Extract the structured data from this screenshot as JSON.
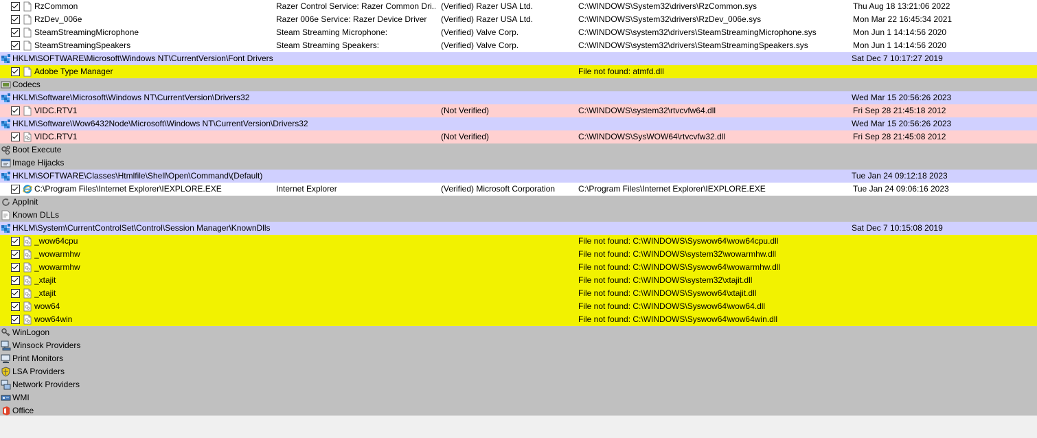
{
  "rows": [
    {
      "type": "item",
      "style": "ok",
      "icon": "file",
      "entry": "RzCommon",
      "description": "Razer Control Service: Razer Common Dri...",
      "publisher": "(Verified) Razer USA Ltd.",
      "image": "C:\\WINDOWS\\System32\\drivers\\RzCommon.sys",
      "time": "Thu Aug 18 13:21:06 2022"
    },
    {
      "type": "item",
      "style": "ok",
      "icon": "file",
      "entry": "RzDev_006e",
      "description": "Razer 006e Service: Razer Device Driver",
      "publisher": "(Verified) Razer USA Ltd.",
      "image": "C:\\WINDOWS\\System32\\drivers\\RzDev_006e.sys",
      "time": "Mon Mar 22 16:45:34 2021"
    },
    {
      "type": "item",
      "style": "ok",
      "icon": "file",
      "entry": "SteamStreamingMicrophone",
      "description": "Steam Streaming Microphone:",
      "publisher": "(Verified) Valve Corp.",
      "image": "C:\\WINDOWS\\system32\\drivers\\SteamStreamingMicrophone.sys",
      "time": "Mon Jun  1 14:14:56 2020"
    },
    {
      "type": "item",
      "style": "ok",
      "icon": "file",
      "entry": "SteamStreamingSpeakers",
      "description": "Steam Streaming Speakers:",
      "publisher": "(Verified) Valve Corp.",
      "image": "C:\\WINDOWS\\system32\\drivers\\SteamStreamingSpeakers.sys",
      "time": "Mon Jun  1 14:14:56 2020"
    },
    {
      "type": "key",
      "icon": "registry",
      "entry": "HKLM\\SOFTWARE\\Microsoft\\Windows NT\\CurrentVersion\\Font Drivers",
      "time": "Sat Dec  7 10:17:27 2019"
    },
    {
      "type": "item",
      "style": "missing",
      "icon": "file",
      "entry": "Adobe Type Manager",
      "description": "",
      "publisher": "",
      "image": "File not found: atmfd.dll",
      "time": ""
    },
    {
      "type": "cat",
      "icon": "codecs",
      "entry": "Codecs"
    },
    {
      "type": "key",
      "icon": "registry",
      "entry": "HKLM\\Software\\Microsoft\\Windows NT\\CurrentVersion\\Drivers32",
      "time": "Wed Mar 15 20:56:26 2023"
    },
    {
      "type": "item",
      "style": "unverified",
      "icon": "file",
      "entry": "VIDC.RTV1",
      "description": "",
      "publisher": "(Not Verified)",
      "image": "C:\\WINDOWS\\system32\\rtvcvfw64.dll",
      "time": "Fri Sep 28 21:45:18 2012"
    },
    {
      "type": "key",
      "icon": "registry",
      "entry": "HKLM\\Software\\Wow6432Node\\Microsoft\\Windows NT\\CurrentVersion\\Drivers32",
      "time": "Wed Mar 15 20:56:26 2023"
    },
    {
      "type": "item",
      "style": "unverified",
      "icon": "dll",
      "entry": "VIDC.RTV1",
      "description": "",
      "publisher": "(Not Verified)",
      "image": "C:\\WINDOWS\\SysWOW64\\rtvcvfw32.dll",
      "time": "Fri Sep 28 21:45:08 2012"
    },
    {
      "type": "cat",
      "icon": "boot-execute",
      "entry": "Boot Execute"
    },
    {
      "type": "cat",
      "icon": "image-hijacks",
      "entry": "Image Hijacks"
    },
    {
      "type": "key",
      "icon": "registry",
      "entry": "HKLM\\SOFTWARE\\Classes\\Htmlfile\\Shell\\Open\\Command\\(Default)",
      "time": "Tue Jan 24 09:12:18 2023"
    },
    {
      "type": "item",
      "style": "ok",
      "icon": "ie",
      "entry": "C:\\Program Files\\Internet Explorer\\IEXPLORE.EXE",
      "description": "Internet Explorer",
      "publisher": "(Verified) Microsoft Corporation",
      "image": "C:\\Program Files\\Internet Explorer\\IEXPLORE.EXE",
      "time": "Tue Jan 24 09:06:16 2023"
    },
    {
      "type": "cat",
      "icon": "appinit",
      "entry": "AppInit"
    },
    {
      "type": "cat",
      "icon": "known-dlls",
      "entry": "Known DLLs"
    },
    {
      "type": "key",
      "icon": "registry",
      "entry": "HKLM\\System\\CurrentControlSet\\Control\\Session Manager\\KnownDlls",
      "time": "Sat Dec  7 10:15:08 2019"
    },
    {
      "type": "item",
      "style": "missing",
      "icon": "dll",
      "entry": "_wow64cpu",
      "description": "",
      "publisher": "",
      "image": "File not found: C:\\WINDOWS\\Syswow64\\wow64cpu.dll",
      "time": ""
    },
    {
      "type": "item",
      "style": "missing",
      "icon": "dll",
      "entry": "_wowarmhw",
      "description": "",
      "publisher": "",
      "image": "File not found: C:\\WINDOWS\\system32\\wowarmhw.dll",
      "time": ""
    },
    {
      "type": "item",
      "style": "missing",
      "icon": "dll",
      "entry": "_wowarmhw",
      "description": "",
      "publisher": "",
      "image": "File not found: C:\\WINDOWS\\Syswow64\\wowarmhw.dll",
      "time": ""
    },
    {
      "type": "item",
      "style": "missing",
      "icon": "dll",
      "entry": "_xtajit",
      "description": "",
      "publisher": "",
      "image": "File not found: C:\\WINDOWS\\system32\\xtajit.dll",
      "time": ""
    },
    {
      "type": "item",
      "style": "missing",
      "icon": "dll",
      "entry": "_xtajit",
      "description": "",
      "publisher": "",
      "image": "File not found: C:\\WINDOWS\\Syswow64\\xtajit.dll",
      "time": ""
    },
    {
      "type": "item",
      "style": "missing",
      "icon": "dll",
      "entry": "wow64",
      "description": "",
      "publisher": "",
      "image": "File not found: C:\\WINDOWS\\Syswow64\\wow64.dll",
      "time": ""
    },
    {
      "type": "item",
      "style": "missing",
      "icon": "dll",
      "entry": "wow64win",
      "description": "",
      "publisher": "",
      "image": "File not found: C:\\WINDOWS\\Syswow64\\wow64win.dll",
      "time": ""
    },
    {
      "type": "cat",
      "icon": "winlogon",
      "entry": "WinLogon"
    },
    {
      "type": "cat",
      "icon": "winsock",
      "entry": "Winsock Providers"
    },
    {
      "type": "cat",
      "icon": "print-monitors",
      "entry": "Print Monitors"
    },
    {
      "type": "cat",
      "icon": "lsa",
      "entry": "LSA Providers"
    },
    {
      "type": "cat",
      "icon": "network",
      "entry": "Network Providers"
    },
    {
      "type": "cat",
      "icon": "wmi",
      "entry": "WMI"
    },
    {
      "type": "cat",
      "icon": "office",
      "entry": "Office"
    }
  ],
  "colors": {
    "key_row": "#d0d0ff",
    "category_row": "#c0c0c0",
    "missing_row": "#f2f200",
    "unverified_row": "#ffd0d0",
    "ok_row": "#ffffff"
  }
}
